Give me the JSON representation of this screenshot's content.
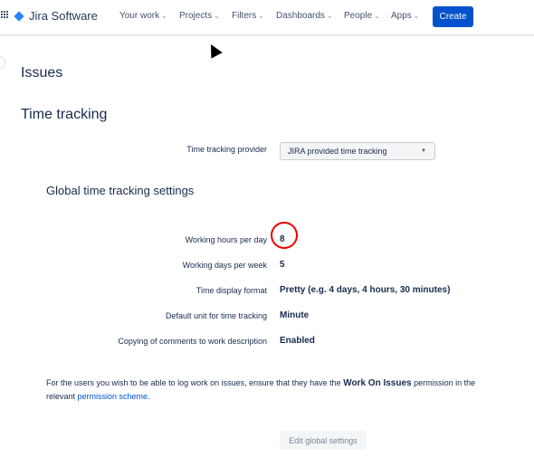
{
  "nav": {
    "app_name": "Jira Software",
    "items": [
      "Your work",
      "Projects",
      "Filters",
      "Dashboards",
      "People",
      "Apps"
    ],
    "create_label": "Create"
  },
  "page": {
    "title": "Issues",
    "section": "Time tracking",
    "provider_label": "Time tracking provider",
    "provider_value": "JIRA provided time tracking",
    "global_heading": "Global time tracking settings"
  },
  "settings": [
    {
      "label": "Working hours per day",
      "value": "8"
    },
    {
      "label": "Working days per week",
      "value": "5"
    },
    {
      "label": "Time display format",
      "value": "Pretty (e.g. 4 days, 4 hours, 30 minutes)"
    },
    {
      "label": "Default unit for time tracking",
      "value": "Minute"
    },
    {
      "label": "Copying of comments to work description",
      "value": "Enabled"
    }
  ],
  "note": {
    "text1": "For the users you wish to be able to log work on issues, ensure that they have the ",
    "perm": "Work On Issues",
    "text2": " permission in the relevant ",
    "link": "permission scheme",
    "text3": "."
  },
  "edit_label": "Edit global settings",
  "colors": {
    "accent": "#0052cc",
    "annotation": "#e00000"
  }
}
